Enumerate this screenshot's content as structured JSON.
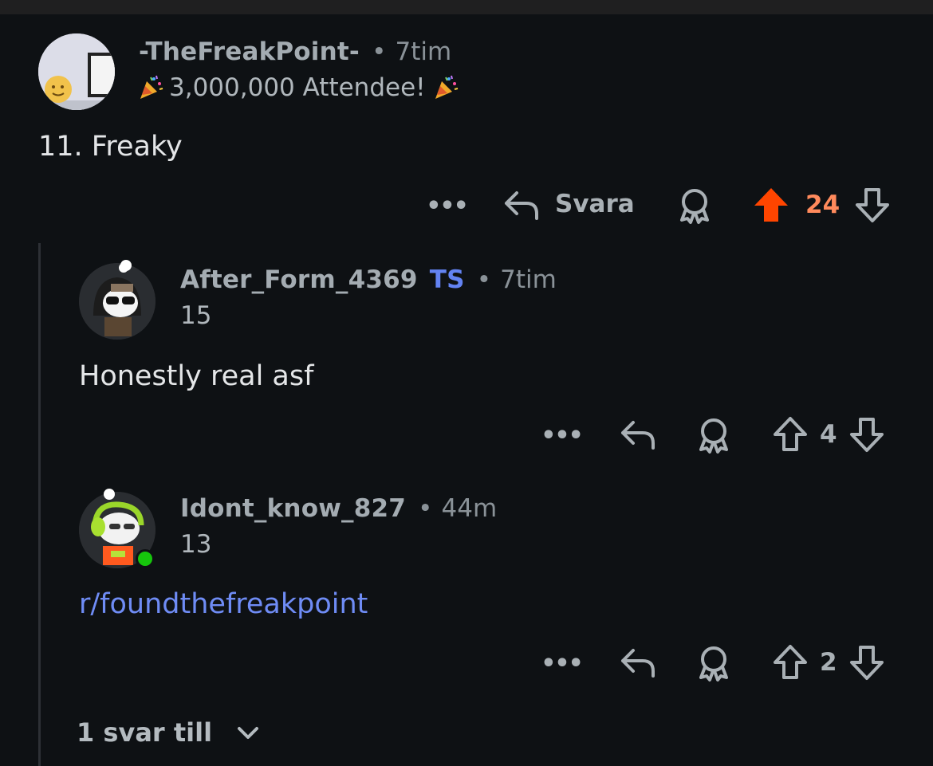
{
  "comments": [
    {
      "username": "-TheFreakPoint-",
      "time": "7tim",
      "flair": "3,000,000 Attendee!",
      "body": "11. Freaky",
      "reply_label": "Svara",
      "votes": "24",
      "upvoted": true
    },
    {
      "username": "After_Form_4369",
      "op_tag": "TS",
      "time": "7tim",
      "flair": "15",
      "body": "Honestly real asf",
      "votes": "4"
    },
    {
      "username": "Idont_know_827",
      "time": "44m",
      "flair": "13",
      "body": "r/foundthefreakpoint",
      "votes": "2",
      "online": true
    }
  ],
  "separator": "•",
  "more_replies": "1 svar till",
  "colors": {
    "background": "#0e1114",
    "upvote": "#ff4500",
    "vote_count_active": "#ff8a5c",
    "op_tag": "#6383f3",
    "link": "#6f8cf5",
    "online": "#16c60c"
  }
}
